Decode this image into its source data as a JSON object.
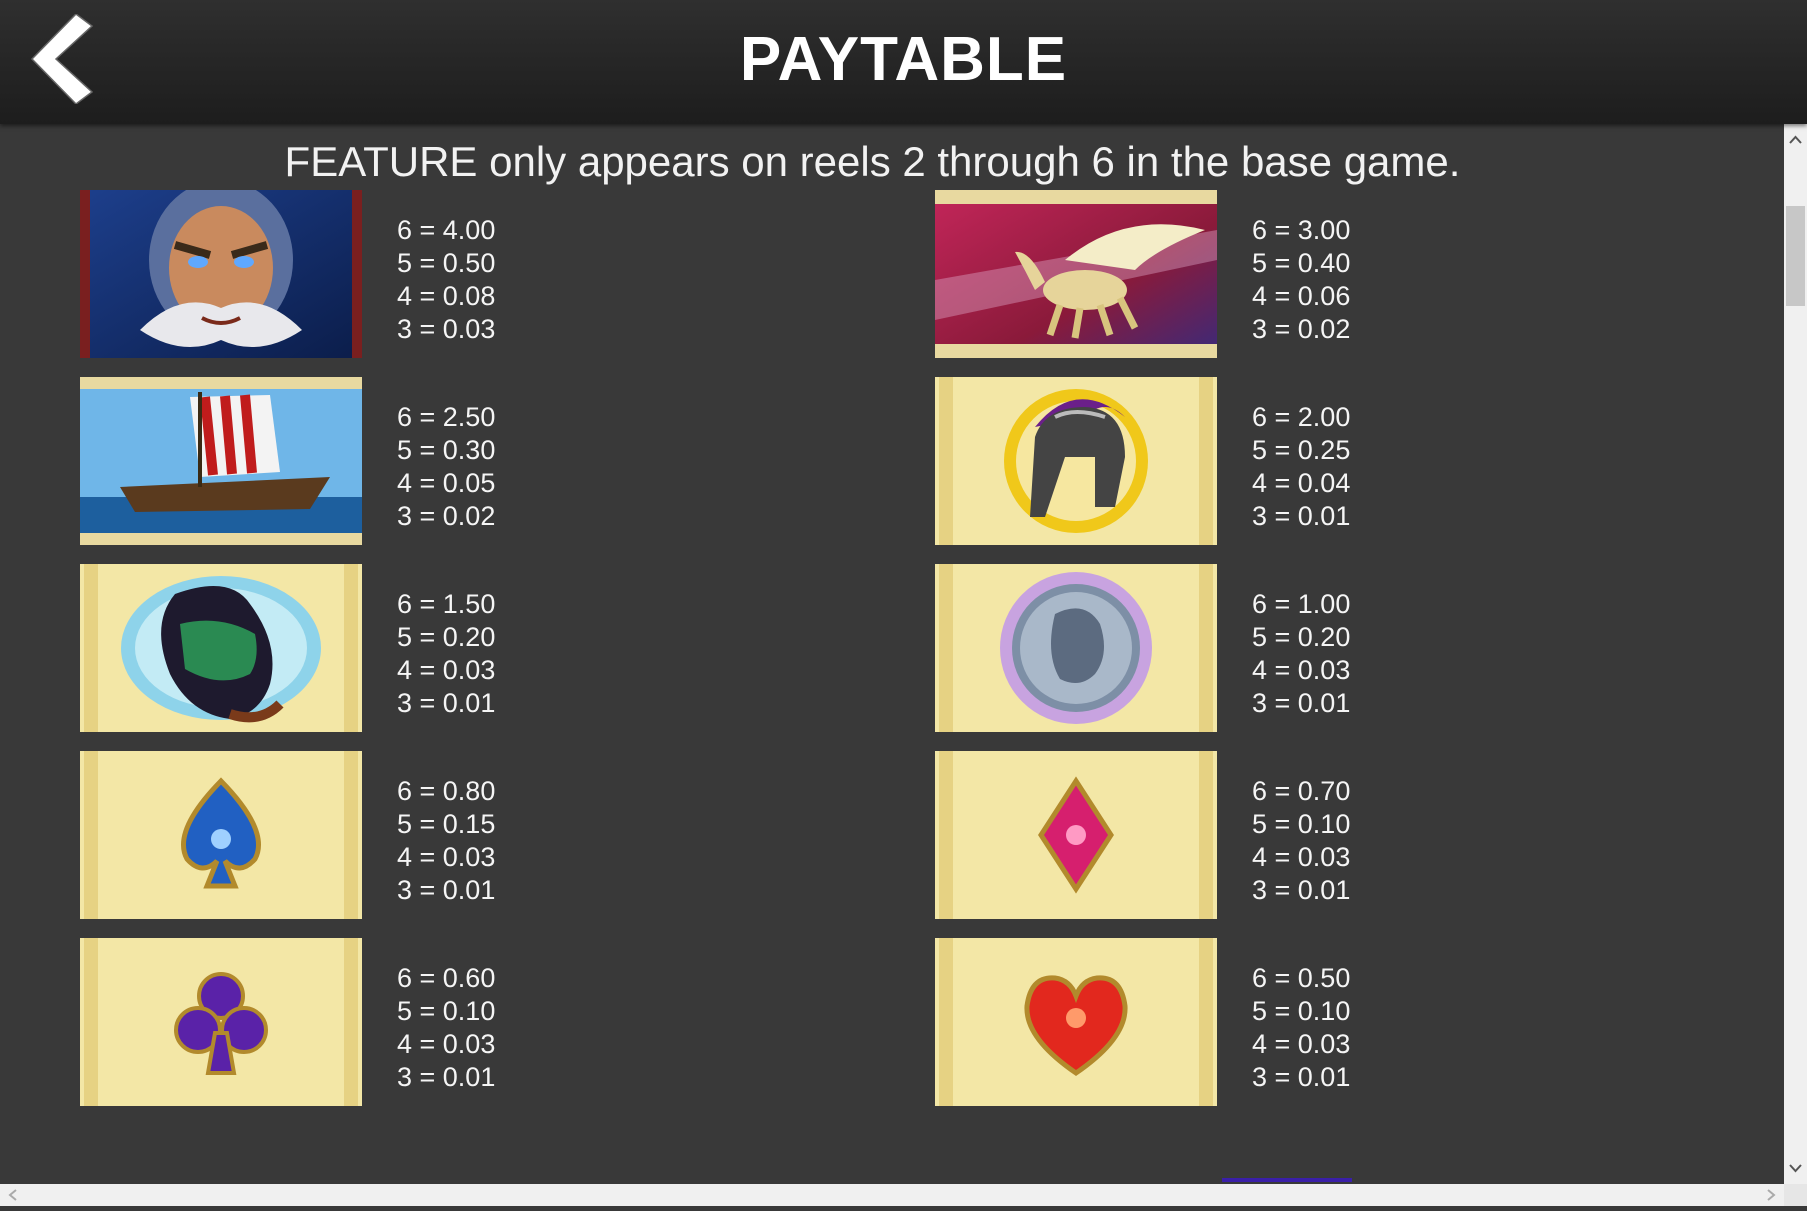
{
  "header": {
    "title": "PAYTABLE",
    "back_icon": "back-chevron-icon"
  },
  "feature_note": "FEATURE only appears on reels 2 through 6 in the base game.",
  "symbols": [
    {
      "icon": "zeus-icon",
      "pays": [
        "6 = 4.00",
        "5 = 0.50",
        "4 = 0.08",
        "3 = 0.03"
      ]
    },
    {
      "icon": "pegasus-icon",
      "pays": [
        "6 = 3.00",
        "5 = 0.40",
        "4 = 0.06",
        "3 = 0.02"
      ]
    },
    {
      "icon": "ship-icon",
      "pays": [
        "6 = 2.50",
        "5 = 0.30",
        "4 = 0.05",
        "3 = 0.02"
      ]
    },
    {
      "icon": "helmet-icon",
      "pays": [
        "6 = 2.00",
        "5 = 0.25",
        "4 = 0.04",
        "3 = 0.01"
      ]
    },
    {
      "icon": "vase-icon",
      "pays": [
        "6 = 1.50",
        "5 = 0.20",
        "4 = 0.03",
        "3 = 0.01"
      ]
    },
    {
      "icon": "coin-icon",
      "pays": [
        "6 = 1.00",
        "5 = 0.20",
        "4 = 0.03",
        "3 = 0.01"
      ]
    },
    {
      "icon": "spade-icon",
      "pays": [
        "6 = 0.80",
        "5 = 0.15",
        "4 = 0.03",
        "3 = 0.01"
      ]
    },
    {
      "icon": "diamond-icon",
      "pays": [
        "6 = 0.70",
        "5 = 0.10",
        "4 = 0.03",
        "3 = 0.01"
      ]
    },
    {
      "icon": "club-icon",
      "pays": [
        "6 = 0.60",
        "5 = 0.10",
        "4 = 0.03",
        "3 = 0.01"
      ]
    },
    {
      "icon": "heart-icon",
      "pays": [
        "6 = 0.50",
        "5 = 0.10",
        "4 = 0.03",
        "3 = 0.01"
      ]
    }
  ],
  "colors": {
    "background": "#393939",
    "header": "#1f1f1f",
    "card_gold": "#f3e7a6",
    "text": "#ffffff"
  }
}
